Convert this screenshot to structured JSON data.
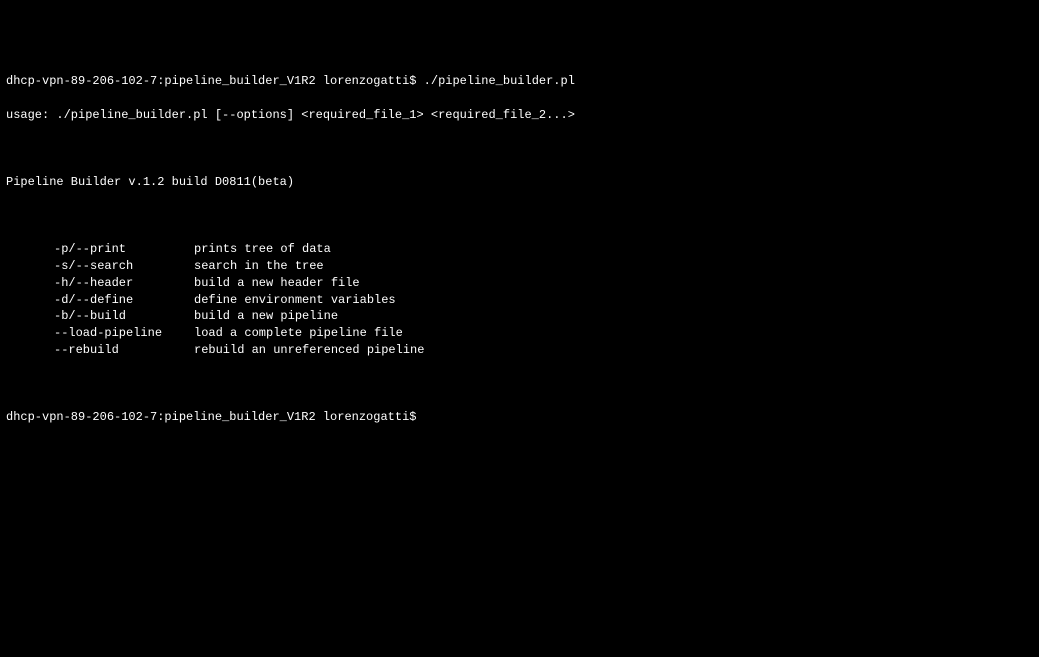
{
  "prompt1": {
    "text": "dhcp-vpn-89-206-102-7:pipeline_builder_V1R2 lorenzogatti$ ",
    "command": "./pipeline_builder.pl"
  },
  "usage": "usage: ./pipeline_builder.pl [--options] <required_file_1> <required_file_2...>",
  "title": "Pipeline Builder v.1.2 build D0811(beta)",
  "options": [
    {
      "flag": "-p/--print",
      "desc": "prints tree of data"
    },
    {
      "flag": "-s/--search",
      "desc": "search in the tree"
    },
    {
      "flag": "-h/--header",
      "desc": "build a new header file"
    },
    {
      "flag": "-d/--define",
      "desc": "define environment variables"
    },
    {
      "flag": "-b/--build",
      "desc": "build a new pipeline"
    },
    {
      "flag": "--load-pipeline",
      "desc": "load a complete pipeline file"
    },
    {
      "flag": "--rebuild",
      "desc": "rebuild an unreferenced pipeline"
    }
  ],
  "prompt2": {
    "text": "dhcp-vpn-89-206-102-7:pipeline_builder_V1R2 lorenzogatti$ ",
    "command": ""
  }
}
